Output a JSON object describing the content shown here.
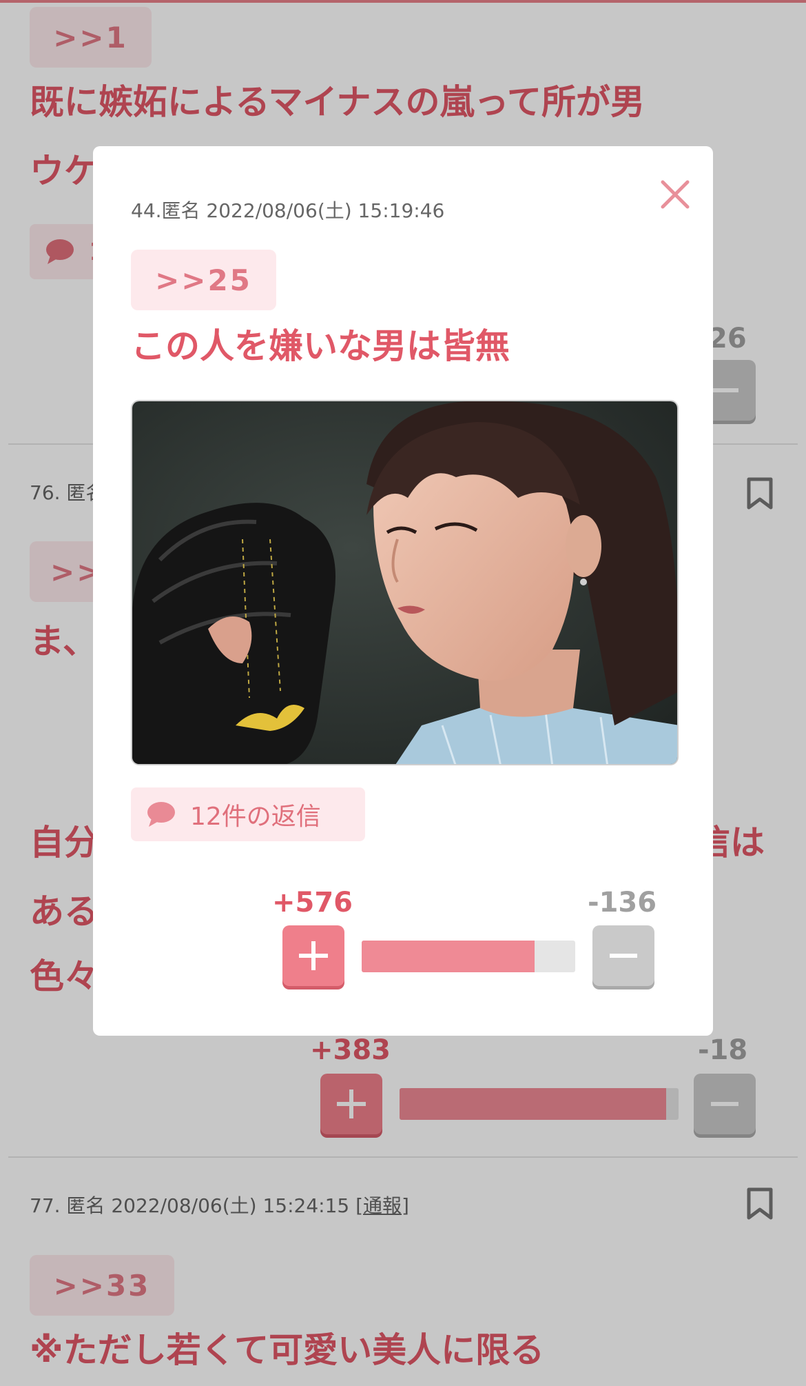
{
  "background": {
    "comment_top": {
      "anchor": ">>1",
      "lines": [
        "既に嫉妬によるマイナスの嵐って所が男",
        "ウケ"
      ],
      "reply_chip_fragment": "1",
      "minus_count_fragment": "26"
    },
    "comment_76": {
      "number_meta": "76. 匿名",
      "anchor": ">>",
      "lines": [
        "ま、",
        "",
        "自分",
        "ある",
        "色々"
      ],
      "right_fragment": "信は",
      "plus_count": "+383",
      "minus_count": "-18",
      "vote_ratio": 0.955
    },
    "comment_77": {
      "meta": "77. 匿名 2022/08/06(土) 15:24:15",
      "report_link": "[通報]",
      "anchor": ">>33",
      "text": "※ただし若くて可愛い美人に限る"
    }
  },
  "modal": {
    "meta": "44.匿名 2022/08/06(土) 15:19:46",
    "anchor": ">>25",
    "text": "この人を嫌いな男は皆無",
    "image_icon": "photo-of-woman-in-pitching-glove",
    "reply_label": "12件の返信",
    "plus_count": "+576",
    "minus_count": "-136",
    "vote_ratio": 0.809
  },
  "colors": {
    "accent_pink": "#ef7f8b",
    "text_red": "#e05867",
    "chip_bg": "#fde9ec",
    "minus_grey": "#c9c9c9"
  },
  "icons": {
    "close": "close-icon",
    "bookmark": "bookmark-icon",
    "speech": "speech-bubble-icon",
    "plus": "plus-icon",
    "minus": "minus-icon"
  }
}
